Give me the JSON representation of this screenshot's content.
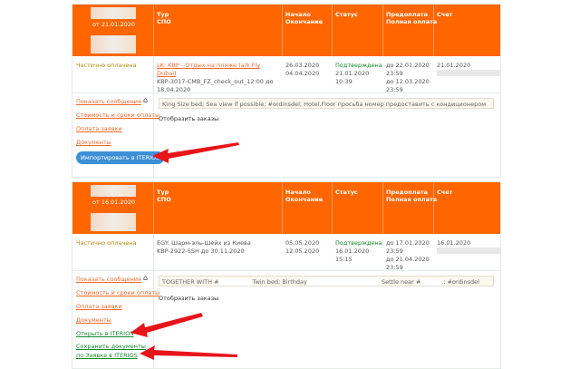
{
  "headers": {
    "tour": "Тур",
    "spo": "СПО",
    "start": "Начало",
    "end": "Окончание",
    "status": "Статус",
    "prepay": "Предоплата",
    "fullpay": "Полная оплата",
    "invoice": "Счет"
  },
  "orders": [
    {
      "date": "от 21.01.2020",
      "payment_state": "Частично оплачена",
      "tour_link": "LK: KBP - Отдых на пляже (a/k Fly Dubai)",
      "spo": "KBP-3017-CMB_FZ_check_out_12:00 до 18.04.2020",
      "start": "26.03.2020",
      "end": "04.04.2020",
      "status": "Подтверждена",
      "status_date": "21.01.2020",
      "status_time": "10:39",
      "prepay": "до 22.01.2020",
      "prepay_time": "23:59",
      "fullpay": "до 12.03.2020",
      "fullpay_time": "23:59",
      "invoice": "21.01.2020",
      "note": "King Size bed; Sea view if possible; #ordinsdel; Hotel.Floor просьба номер предоставить с кондиционером",
      "show_orders": "Отобразить заказы",
      "links": [
        "Показать сообщения",
        "Стоимость и сроки оплаты",
        "Оплата заявки",
        "Документы"
      ],
      "import_button": "Импортировать в ITERIOS"
    },
    {
      "date": "от 16.01.2020",
      "payment_state": "Частично оплачена",
      "tour": "EGY: Шарм-эль-Шейх из Киева",
      "spo": "KBP-2922-SSH до 30.11.2020",
      "start": "05.05.2020",
      "end": "12.05.2020",
      "status": "Подтверждена",
      "status_date": "16.01.2020",
      "status_time": "15:15",
      "prepay": "до 17.01.2020",
      "prepay_time": "23:59",
      "fullpay": "до 21.04.2020",
      "fullpay_time": "23:59",
      "invoice": "16.01.2020",
      "note_a": "TOGETHER WITH #",
      "note_b": "Twin bed; Birthday",
      "note_c": "Settle near #",
      "note_d": "; #ordinsdel",
      "show_orders": "Отобразить заказы",
      "links": [
        "Показать сообщения",
        "Стоимость и сроки оплаты",
        "Оплата заявки",
        "Документы"
      ],
      "open_link": "Открыть в ITERIOS",
      "save_link": "Сохранить документы по Заявке в ITERIOS"
    }
  ],
  "colors": {
    "header": "#ff6600",
    "link": "#f26a2a",
    "status": "#138a2b",
    "button": "#3d8fd6"
  }
}
